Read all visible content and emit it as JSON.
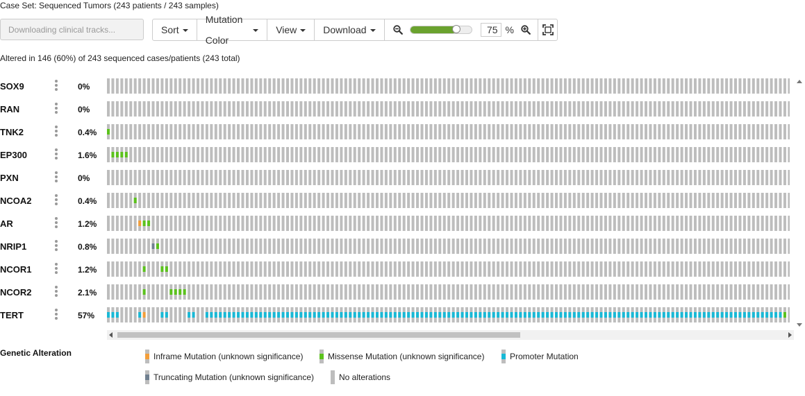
{
  "header": {
    "case_set": "Case Set: Sequenced Tumors (243 patients / 243 samples)"
  },
  "toolbar": {
    "clinical_tracks_label": "Downloading clinical tracks...",
    "sort_label": "Sort",
    "mutation_color_label": "Mutation Color",
    "view_label": "View",
    "download_label": "Download",
    "zoom_value": "75",
    "zoom_percent_sign": "%",
    "zoom_level": 0.75
  },
  "summary": {
    "altered_text": "Altered in 146 (60%) of 243 sequenced cases/patients (243 total)"
  },
  "colors": {
    "no_alteration": "#bdbdbd",
    "missense": "#5bc21c",
    "inframe": "#f39e3a",
    "promoter": "#18b9d6",
    "truncating": "#708090",
    "slider_fill": "#6aa22e"
  },
  "tracks": [
    {
      "gene": "SOX9",
      "pct": "0%"
    },
    {
      "gene": "RAN",
      "pct": "0%"
    },
    {
      "gene": "TNK2",
      "pct": "0.4%"
    },
    {
      "gene": "EP300",
      "pct": "1.6%"
    },
    {
      "gene": "PXN",
      "pct": "0%"
    },
    {
      "gene": "NCOA2",
      "pct": "0.4%"
    },
    {
      "gene": "AR",
      "pct": "1.2%"
    },
    {
      "gene": "NRIP1",
      "pct": "0.8%"
    },
    {
      "gene": "NCOR1",
      "pct": "1.2%"
    },
    {
      "gene": "NCOR2",
      "pct": "2.1%"
    },
    {
      "gene": "TERT",
      "pct": "57%"
    }
  ],
  "legend": {
    "title": "Genetic Alteration",
    "items": [
      {
        "label": "Inframe Mutation (unknown significance)",
        "color_key": "inframe"
      },
      {
        "label": "Missense Mutation (unknown significance)",
        "color_key": "missense"
      },
      {
        "label": "Promoter Mutation",
        "color_key": "promoter"
      },
      {
        "label": "Truncating Mutation (unknown significance)",
        "color_key": "truncating"
      },
      {
        "label": "No alterations",
        "color_key": "no_alteration"
      }
    ]
  }
}
